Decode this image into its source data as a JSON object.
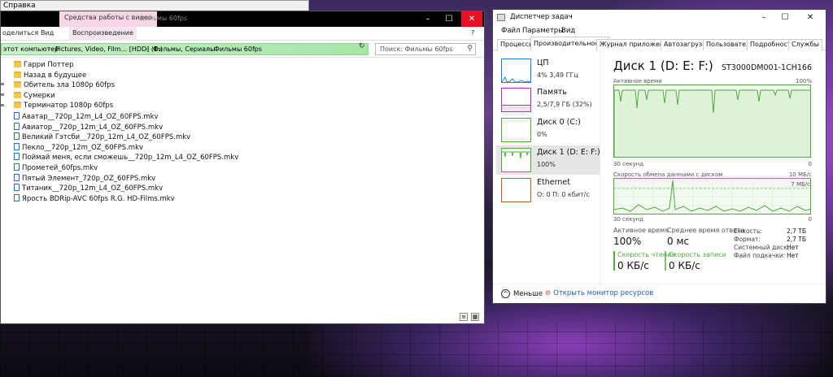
{
  "behind_window": {
    "menu_label": "Справка"
  },
  "explorer": {
    "context_tab": "Средства работы с видео",
    "window_title": "Фильмы 60fps",
    "controls": {
      "minimize": "–",
      "maximize": "☐",
      "close": "✕"
    },
    "ribbon": {
      "share": "оделиться",
      "view": "Вид",
      "playback": "Воспроизведение",
      "help": "?"
    },
    "breadcrumbs": [
      "этот компьютер",
      "Pictures, Video, Film... [HDD] (E:)",
      "Фильмы, Сериалы",
      "Фильмы 60fps"
    ],
    "search_placeholder": "Поиск: Фильмы 60fps",
    "items": [
      {
        "name": "Гарри Поттер",
        "type": "folder"
      },
      {
        "name": "Назад в будущее",
        "type": "folder"
      },
      {
        "name": "Обитель зла 1080p 60fps",
        "type": "folder"
      },
      {
        "name": "Сумерки",
        "type": "folder"
      },
      {
        "name": "Терминатор 1080p 60fps",
        "type": "folder"
      },
      {
        "name": "Аватар__720p_12m_L4_OZ_60FPS.mkv",
        "type": "mkv"
      },
      {
        "name": "Авиатор__720p_12m_L4_OZ_60FPS.mkv",
        "type": "mkv"
      },
      {
        "name": "Великий Гэтсби__720p_12m_L4_OZ_60FPS.mkv",
        "type": "mkv"
      },
      {
        "name": "Пекло__720p_12m_OZ_60FPS.mkv",
        "type": "mkv"
      },
      {
        "name": "Поймай меня, если сможешь__720p_12m_L4_OZ_60FPS.mkv",
        "type": "mkv"
      },
      {
        "name": "Прометей_60fps.mkv",
        "type": "mkv"
      },
      {
        "name": "Пятый Элемент_720p_OZ_60FPS.mkv",
        "type": "mkv"
      },
      {
        "name": "Титаник__720p_12m_L4_OZ_60FPS.mkv",
        "type": "mkv"
      },
      {
        "name": "Ярость BDRip-AVC 60fps R.G. HD-Films.mkv",
        "type": "mkv"
      }
    ]
  },
  "taskmgr": {
    "title": "Диспетчер задач",
    "menu": [
      "Файл",
      "Параметры",
      "Вид"
    ],
    "tabs": [
      "Процессы",
      "Производительность",
      "Журнал приложений",
      "Автозагрузка",
      "Пользователи",
      "Подробности",
      "Службы"
    ],
    "active_tab": "Производительность",
    "sidebar": [
      {
        "name": "ЦП",
        "value": "4% 3,49 ГГц",
        "color": "#1e7fd6"
      },
      {
        "name": "Память",
        "value": "2,5/7,9 ГБ (32%)",
        "color": "#a23bb5"
      },
      {
        "name": "Диск 0 (C:)",
        "value": "0%",
        "color": "#4caa3a"
      },
      {
        "name": "Диск 1 (D: E: F:)",
        "value": "100%",
        "color": "#4caa3a"
      },
      {
        "name": "Ethernet",
        "value": "О: 0 П: 0 кбит/с",
        "color": "#b5631e"
      }
    ],
    "main": {
      "title": "Диск 1 (D: E: F:)",
      "model": "ST3000DM001-1CH166",
      "graph1": {
        "label": "Активное время",
        "max": "100%",
        "time": "30 секунд",
        "min": "0"
      },
      "graph2": {
        "label": "Скорость обмена данными с диском",
        "max": "10 МБ/с",
        "line": "7 МБ/с",
        "time": "30 секунд",
        "min": "0"
      },
      "active_time": {
        "label": "Активное время",
        "value": "100%"
      },
      "response_time": {
        "label": "Среднее время ответа",
        "value": "0 мс"
      },
      "read_speed": {
        "label": "Скорость чтения",
        "value": "0 КБ/с"
      },
      "write_speed": {
        "label": "Скорость записи",
        "value": "0 КБ/с"
      },
      "props": [
        {
          "k": "Емкость:",
          "v": "2,7 ТБ"
        },
        {
          "k": "Формат:",
          "v": "2,7 ТБ"
        },
        {
          "k": "Системный диск:",
          "v": "Нет"
        },
        {
          "k": "Файл подкачки:",
          "v": "Нет"
        }
      ]
    },
    "footer": {
      "fewer": "Меньше",
      "resmon": "Открыть монитор ресурсов"
    }
  }
}
